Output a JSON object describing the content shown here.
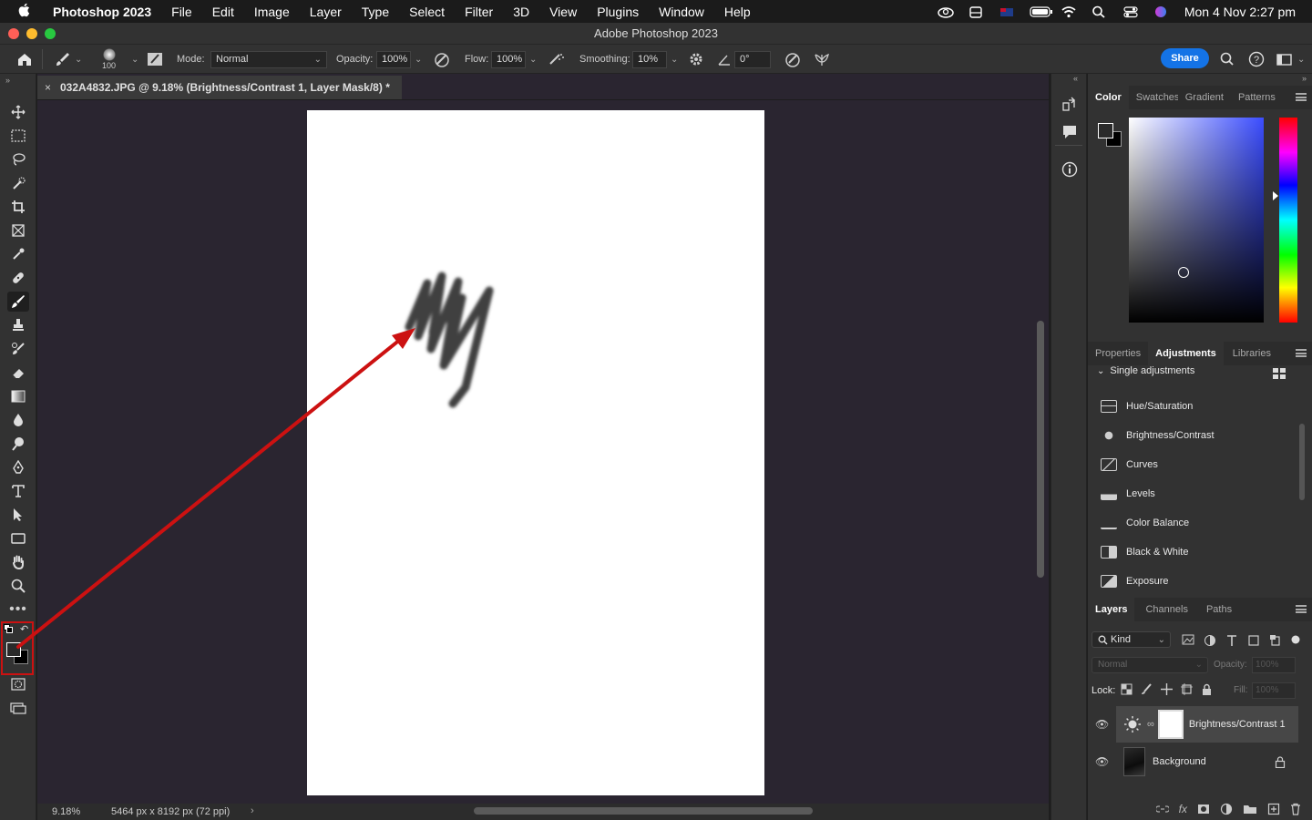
{
  "menubar": {
    "apple_icon": "apple-icon",
    "items": [
      "Photoshop 2023",
      "File",
      "Edit",
      "Image",
      "Layer",
      "Type",
      "Select",
      "Filter",
      "3D",
      "View",
      "Plugins",
      "Window",
      "Help"
    ],
    "datetime": "Mon 4 Nov  2:27 pm"
  },
  "window": {
    "title": "Adobe Photoshop 2023"
  },
  "options": {
    "brush_size": "100",
    "mode_label": "Mode:",
    "mode_value": "Normal",
    "opacity_label": "Opacity:",
    "opacity_value": "100%",
    "flow_label": "Flow:",
    "flow_value": "100%",
    "smoothing_label": "Smoothing:",
    "smoothing_value": "10%",
    "angle_value": "0°",
    "share_label": "Share"
  },
  "document": {
    "tab_title": "032A4832.JPG @ 9.18% (Brightness/Contrast 1, Layer Mask/8) *",
    "zoom": "9.18%",
    "size_info": "5464 px x 8192 px (72 ppi)"
  },
  "color_panel": {
    "tabs": [
      "Color",
      "Swatches",
      "Gradient",
      "Patterns"
    ],
    "active_tab": "Color",
    "foreground": "#2a2a2a",
    "background": "#000000"
  },
  "adjustments_panel": {
    "tabs": [
      "Properties",
      "Adjustments",
      "Libraries"
    ],
    "section_title": "Single adjustments",
    "items": [
      "Hue/Saturation",
      "Brightness/Contrast",
      "Curves",
      "Levels",
      "Color Balance",
      "Black & White",
      "Exposure"
    ]
  },
  "layers_panel": {
    "tabs": [
      "Layers",
      "Channels",
      "Paths"
    ],
    "filter_label": "Kind",
    "blend_mode": "Normal",
    "opacity_label": "Opacity:",
    "opacity_value": "100%",
    "lock_label": "Lock:",
    "fill_label": "Fill:",
    "fill_value": "100%",
    "layers": [
      {
        "name": "Brightness/Contrast 1",
        "type": "adjustment"
      },
      {
        "name": "Background",
        "type": "image",
        "locked": true
      }
    ]
  },
  "annotation": {
    "arrow_color": "#cc1111",
    "highlight_color": "#cc1111"
  }
}
